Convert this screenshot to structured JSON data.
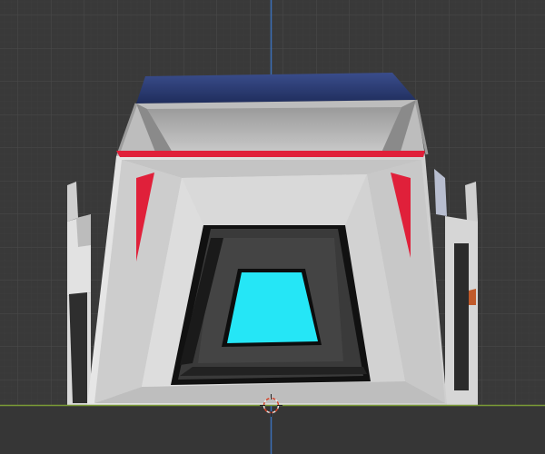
{
  "viewport": {
    "view": "front-orthographic",
    "background_color": "#393939",
    "grid_color": "#474747",
    "axis_x_color": "#7a9a36",
    "axis_z_color": "#3b6fb8",
    "origin_marker": "3d-cursor-icon"
  },
  "model": {
    "name": "",
    "body_color": "#d3d3d3",
    "roof_color": "#2a3d78",
    "accent_color": "#e0203a",
    "screen_color": "#25e6f6",
    "frame_color": "#3a3a3a"
  }
}
